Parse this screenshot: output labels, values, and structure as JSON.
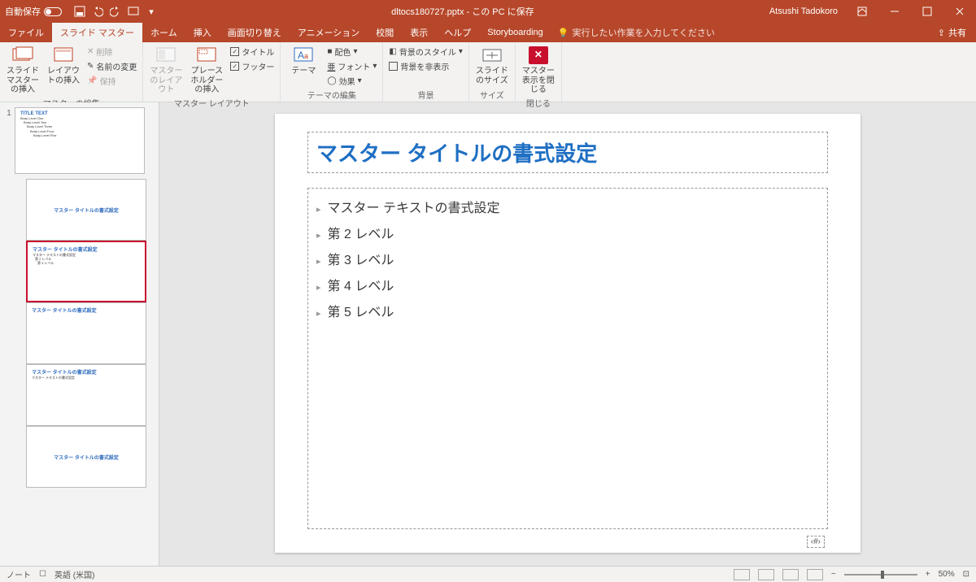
{
  "titlebar": {
    "autosave": "自動保存",
    "title": "dltocs180727.pptx - この PC に保存",
    "user": "Atsushi Tadokoro"
  },
  "tabs": {
    "file": "ファイル",
    "master": "スライド マスター",
    "home": "ホーム",
    "insert": "挿入",
    "transition": "画面切り替え",
    "anim": "アニメーション",
    "review": "校閲",
    "view": "表示",
    "help": "ヘルプ",
    "storyboard": "Storyboarding",
    "tell": "実行したい作業を入力してください",
    "share": "共有"
  },
  "ribbon": {
    "edit": {
      "insertMaster": "スライド マスターの挿入",
      "insertLayout": "レイアウトの挿入",
      "delete": "削除",
      "rename": "名前の変更",
      "preserve": "保持",
      "label": "マスターの編集"
    },
    "layout": {
      "masterLayout": "マスターのレイアウト",
      "placeholder": "プレースホルダーの挿入",
      "title": "タイトル",
      "footer": "フッター",
      "label": "マスター レイアウト"
    },
    "theme": {
      "theme": "テーマ",
      "colors": "配色",
      "fonts": "フォント",
      "effects": "効果",
      "label": "テーマの編集"
    },
    "bg": {
      "bgstyle": "背景のスタイル",
      "hide": "背景を非表示",
      "label": "背景"
    },
    "size": {
      "btn": "スライドのサイズ",
      "label": "サイズ"
    },
    "close": {
      "btn": "マスター表示を閉じる",
      "label": "閉じる"
    }
  },
  "thumbs": {
    "num": "1",
    "titleText": "TITLE TEXT",
    "body": [
      "Body Level One",
      "Body Level Two",
      "Body Level Three",
      "Body Level Four",
      "Body Level Five"
    ],
    "subTitle": "マスター タイトルの書式設定"
  },
  "slide": {
    "title": "マスター タイトルの書式設定",
    "lv1": "マスター テキストの書式設定",
    "lv2": "第 2 レベル",
    "lv3": "第 3 レベル",
    "lv4": "第 4 レベル",
    "lv5": "第 5 レベル",
    "pnum": "‹#›"
  },
  "status": {
    "notes": "ノート",
    "lang": "英語 (米国)",
    "zoom": "50%"
  }
}
